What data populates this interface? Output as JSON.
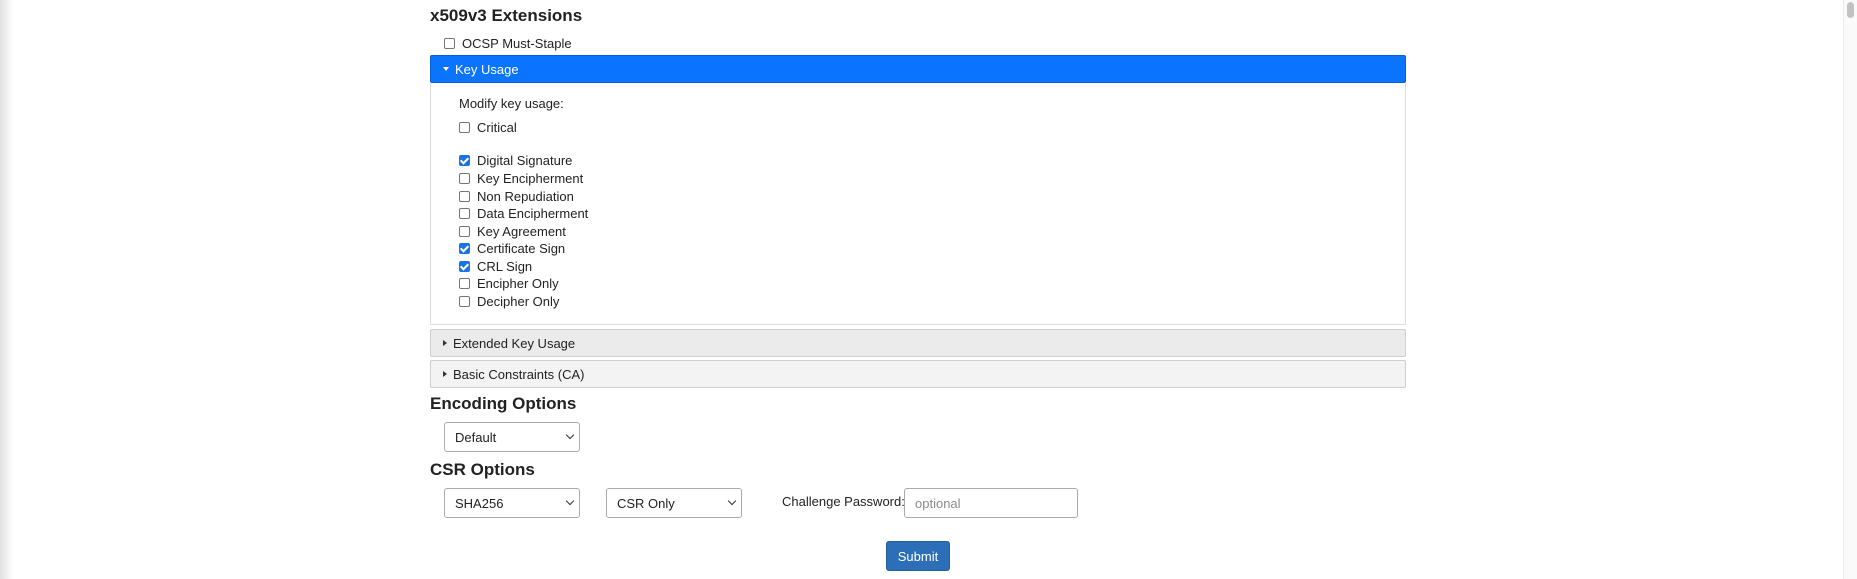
{
  "x509": {
    "title": "x509v3 Extensions",
    "ocsp_label": "OCSP Must-Staple",
    "ocsp_checked": false
  },
  "key_usage": {
    "header": "Key Usage",
    "modify_label": "Modify key usage:",
    "critical_label": "Critical",
    "critical_checked": false,
    "items": [
      {
        "label": "Digital Signature",
        "checked": true
      },
      {
        "label": "Key Encipherment",
        "checked": false
      },
      {
        "label": "Non Repudiation",
        "checked": false
      },
      {
        "label": "Data Encipherment",
        "checked": false
      },
      {
        "label": "Key Agreement",
        "checked": false
      },
      {
        "label": "Certificate Sign",
        "checked": true
      },
      {
        "label": "CRL Sign",
        "checked": true
      },
      {
        "label": "Encipher Only",
        "checked": false
      },
      {
        "label": "Decipher Only",
        "checked": false
      }
    ]
  },
  "extended_key_usage": {
    "header": "Extended Key Usage"
  },
  "basic_constraints": {
    "header": "Basic Constraints (CA)"
  },
  "encoding": {
    "title": "Encoding Options",
    "selected": "Default"
  },
  "csr": {
    "title": "CSR Options",
    "hash_selected": "SHA256",
    "type_selected": "CSR Only",
    "challenge_label": "Challenge Password:",
    "challenge_placeholder": "optional",
    "challenge_value": ""
  },
  "submit_label": "Submit",
  "colors": {
    "accent": "#0b74ff",
    "submit": "#2c6fb8"
  }
}
